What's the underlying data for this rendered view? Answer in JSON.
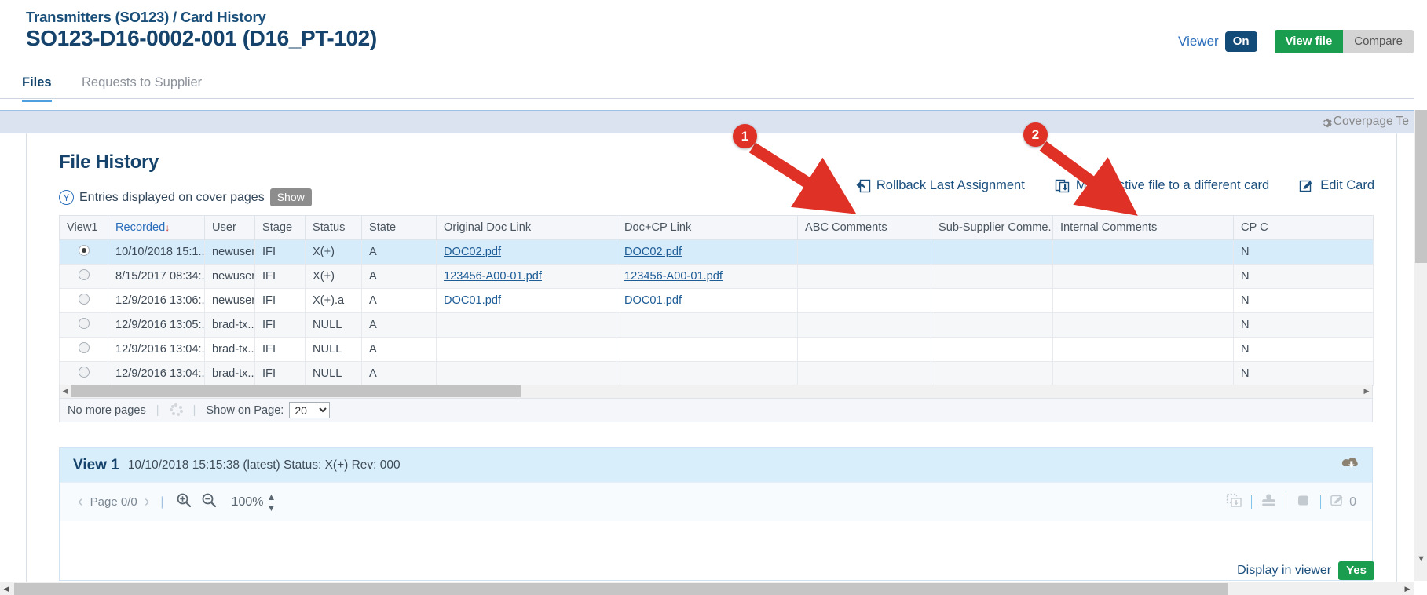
{
  "header": {
    "breadcrumb": "Transmitters (SO123) / Card History",
    "card_title": "SO123-D16-0002-001 (D16_PT-102)",
    "viewer_label": "Viewer",
    "viewer_state": "On",
    "view_file_label": "View file",
    "compare_label": "Compare"
  },
  "tabs": [
    {
      "label": "Files",
      "active": true
    },
    {
      "label": "Requests to Supplier",
      "active": false
    }
  ],
  "coverbar": {
    "coverpage_template_label": "Coverpage Te",
    "gear_icon": "gear-icon"
  },
  "file_history": {
    "section_title": "File History",
    "entries_flag": "Y",
    "entries_text": "Entries displayed on cover pages",
    "show_label": "Show",
    "actions": [
      {
        "label": "Rollback Last Assignment",
        "icon": "rollback-icon"
      },
      {
        "label": "Move active file to a different card",
        "icon": "move-file-icon"
      },
      {
        "label": "Edit Card",
        "icon": "edit-card-icon"
      }
    ]
  },
  "table": {
    "columns": [
      "View1",
      "Recorded",
      "User",
      "Stage",
      "Status",
      "State",
      "Original Doc Link",
      "Doc+CP Link",
      "ABC Comments",
      "Sub-Supplier Comme...",
      "Internal Comments",
      "CP C"
    ],
    "sorted_column": "Recorded",
    "sort_direction": "desc",
    "rows": [
      {
        "selected": true,
        "recorded": "10/10/2018 15:1...",
        "user": "newuser",
        "stage": "IFI",
        "status": "X(+)",
        "state": "A",
        "original_doc_link": "DOC02.pdf",
        "doc_cp_link": "DOC02.pdf",
        "abc_comments": "",
        "sub_supplier_comments": "",
        "internal_comments": "",
        "cp_c": "N"
      },
      {
        "selected": false,
        "recorded": "8/15/2017 08:34:...",
        "user": "newuser",
        "stage": "IFI",
        "status": "X(+)",
        "state": "A",
        "original_doc_link": "123456-A00-01.pdf",
        "doc_cp_link": "123456-A00-01.pdf",
        "abc_comments": "",
        "sub_supplier_comments": "",
        "internal_comments": "",
        "cp_c": "N"
      },
      {
        "selected": false,
        "recorded": "12/9/2016 13:06:...",
        "user": "newuser",
        "stage": "IFI",
        "status": "X(+).a",
        "state": "A",
        "original_doc_link": "DOC01.pdf",
        "doc_cp_link": "DOC01.pdf",
        "abc_comments": "",
        "sub_supplier_comments": "",
        "internal_comments": "",
        "cp_c": "N"
      },
      {
        "selected": false,
        "recorded": "12/9/2016 13:05:...",
        "user": "brad-tx...",
        "stage": "IFI",
        "status": "NULL",
        "state": "A",
        "original_doc_link": "",
        "doc_cp_link": "",
        "abc_comments": "",
        "sub_supplier_comments": "",
        "internal_comments": "",
        "cp_c": "N"
      },
      {
        "selected": false,
        "recorded": "12/9/2016 13:04:...",
        "user": "brad-tx...",
        "stage": "IFI",
        "status": "NULL",
        "state": "A",
        "original_doc_link": "",
        "doc_cp_link": "",
        "abc_comments": "",
        "sub_supplier_comments": "",
        "internal_comments": "",
        "cp_c": "N"
      },
      {
        "selected": false,
        "recorded": "12/9/2016 13:04:...",
        "user": "brad-tx...",
        "stage": "IFI",
        "status": "NULL",
        "state": "A",
        "original_doc_link": "",
        "doc_cp_link": "",
        "abc_comments": "",
        "sub_supplier_comments": "",
        "internal_comments": "",
        "cp_c": "N"
      }
    ]
  },
  "pager": {
    "no_more_pages": "No more pages",
    "show_on_page_label": "Show on Page:",
    "show_on_page_value": "20",
    "show_on_page_options": [
      "20"
    ]
  },
  "view_panel": {
    "view_label": "View 1",
    "meta": "10/10/2018 15:15:38 (latest) Status: X(+) Rev: 000",
    "download_icon": "cloud-download-icon",
    "toolbar": {
      "prev_icon": "chevron-left-icon",
      "page_label": "Page 0/0",
      "next_icon": "chevron-right-icon",
      "zoom_in_icon": "zoom-in-icon",
      "zoom_out_icon": "zoom-out-icon",
      "zoom_percent": "100%",
      "stepper_icon": "updown-stepper-icon",
      "snapshot_icon": "snapshot-icon",
      "stamp_icon": "stamp-icon",
      "redact_icon": "redact-icon",
      "annotate_icon": "annotate-icon",
      "annotate_count": "0"
    }
  },
  "footer": {
    "display_in_viewer_label": "Display in viewer",
    "display_in_viewer_value": "Yes"
  },
  "annotations": [
    {
      "number": "1",
      "target": "Rollback Last Assignment"
    },
    {
      "number": "2",
      "target": "Move active file to a different card"
    }
  ],
  "colors": {
    "brand_dark_blue": "#15436b",
    "link_blue": "#1b4f7e",
    "accent_blue": "#2a6ebb",
    "green": "#1a9d4e",
    "annotation_red": "#e03127",
    "selected_row": "#d6ecfb",
    "coverbar": "#dbe3f0"
  }
}
